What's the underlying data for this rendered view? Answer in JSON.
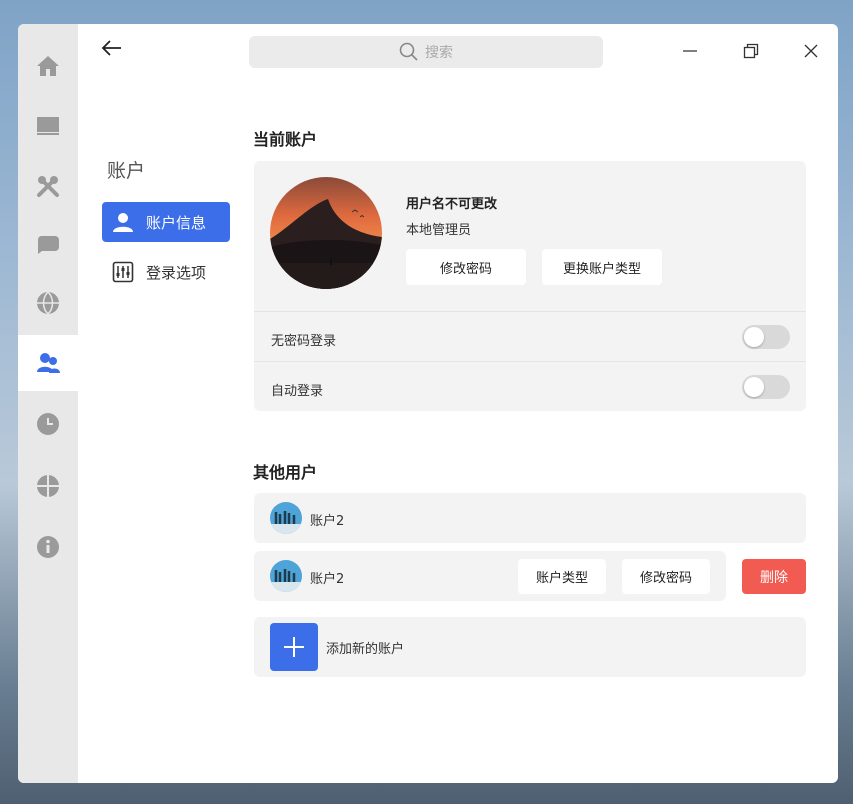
{
  "colors": {
    "accent": "#3b6ee8",
    "danger": "#f25b52",
    "rail_bg": "#e8e8e8",
    "card_bg": "#f3f3f3",
    "toggle_off": "#d9d9d9"
  },
  "rail": {
    "items": [
      {
        "icon": "home-icon"
      },
      {
        "icon": "display-icon"
      },
      {
        "icon": "tools-icon"
      },
      {
        "icon": "chat-bubble-icon"
      },
      {
        "icon": "globe-icon"
      },
      {
        "icon": "users-icon",
        "active": true
      },
      {
        "icon": "clock-icon"
      },
      {
        "icon": "update-icon"
      },
      {
        "icon": "info-icon"
      }
    ]
  },
  "search": {
    "placeholder": "搜索"
  },
  "sidebar": {
    "title": "账户",
    "items": [
      {
        "label": "账户信息",
        "icon": "user-icon",
        "active": true
      },
      {
        "label": "登录选项",
        "icon": "sliders-icon",
        "active": false
      }
    ]
  },
  "current_account": {
    "section_title": "当前账户",
    "username": "用户名不可更改",
    "user_type": "本地管理员",
    "change_password": "修改密码",
    "change_type": "更换账户类型",
    "options": [
      {
        "label": "无密码登录",
        "enabled": false
      },
      {
        "label": "自动登录",
        "enabled": false
      }
    ]
  },
  "other_users": {
    "section_title": "其他用户",
    "users": [
      {
        "name": "账户2"
      },
      {
        "name": "账户2",
        "type_button": "账户类型",
        "password_button": "修改密码",
        "delete_button": "删除"
      }
    ],
    "add_label": "添加新的账户"
  }
}
